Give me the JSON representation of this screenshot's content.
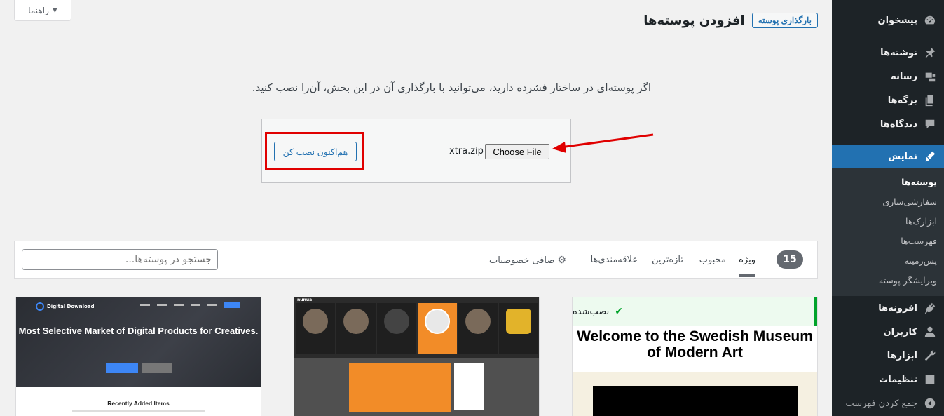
{
  "help": {
    "label": "راهنما"
  },
  "header": {
    "title": "افزودن پوسته‌ها",
    "upload_button": "بارگذاری پوسته"
  },
  "upload": {
    "description": "اگر پوسته‌ای در ساختار فشرده دارید، می‌توانید با بارگذاری آن در این بخش، آن‌را نصب کنید.",
    "choose_file": "Choose File",
    "file_name": "xtra.zip",
    "install_button": "هم‌اکنون نصب کن"
  },
  "filter": {
    "count": "15",
    "tabs": [
      "ویژه",
      "محبوب",
      "تازه‌ترین",
      "علاقه‌مندی‌ها"
    ],
    "feature_filter": "صافی خصوصیات",
    "search_placeholder": "جستجو در پوسته‌ها..."
  },
  "themes": [
    {
      "hero_title": "Most Selective Market of Digital Products for Creatives.",
      "brand": "Digital Download",
      "recent": "Recently Added Items"
    },
    {
      "brand": "nunua"
    },
    {
      "installed_label": "نصب‌شده",
      "hero_title": "Welcome to the Swedish Museum of Modern Art"
    }
  ],
  "sidebar": {
    "items": [
      {
        "label": "پیشخوان",
        "icon": "dashboard-icon"
      },
      {
        "label": "نوشته‌ها",
        "icon": "pin-icon"
      },
      {
        "label": "رسانه",
        "icon": "media-icon"
      },
      {
        "label": "برگه‌ها",
        "icon": "pages-icon"
      },
      {
        "label": "دیدگاه‌ها",
        "icon": "comments-icon"
      },
      {
        "label": "نمایش",
        "icon": "appearance-icon"
      },
      {
        "label": "افزونه‌ها",
        "icon": "plugins-icon"
      },
      {
        "label": "کاربران",
        "icon": "users-icon"
      },
      {
        "label": "ابزارها",
        "icon": "tools-icon"
      },
      {
        "label": "تنظیمات",
        "icon": "settings-icon"
      },
      {
        "label": "جمع کردن فهرست",
        "icon": "collapse-icon"
      }
    ],
    "submenu": [
      "پوسته‌ها",
      "سفارشی‌سازی",
      "ابزارک‌ها",
      "فهرست‌ها",
      "پس‌زمینه",
      "ویرایشگر پوسته"
    ]
  },
  "colors": {
    "accent": "#2271b1",
    "sidebar": "#1d2327",
    "highlight": "#e00000",
    "installed": "#00a32a"
  }
}
